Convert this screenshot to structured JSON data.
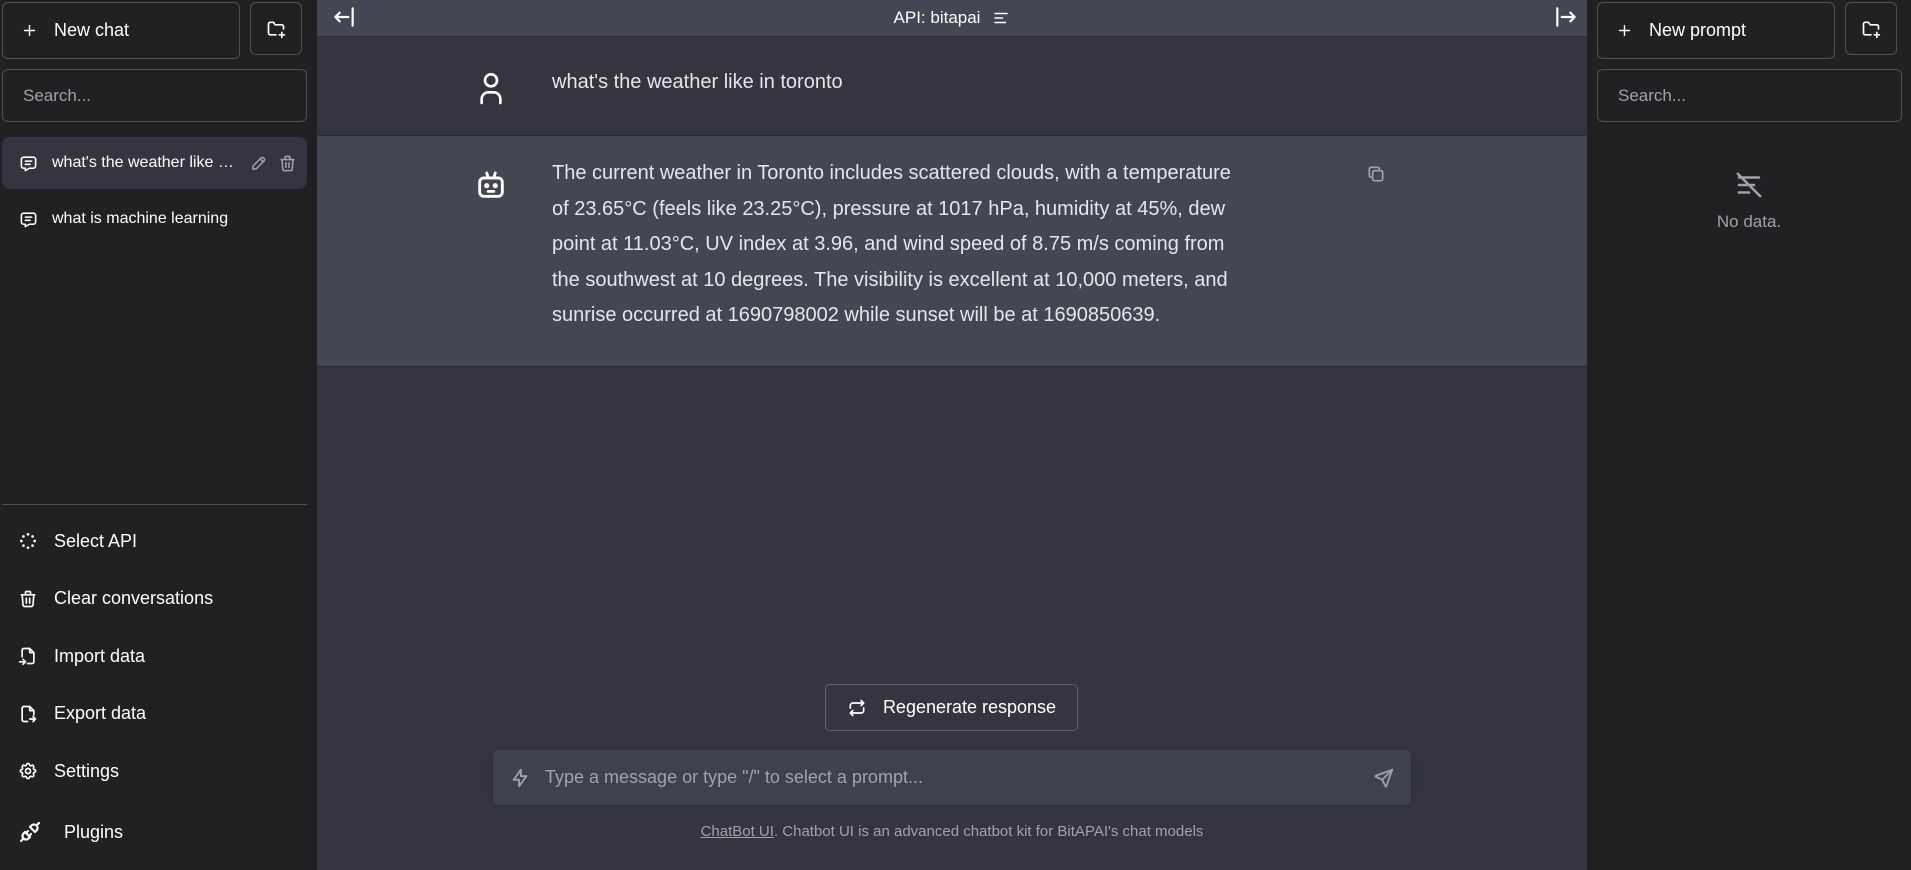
{
  "left_sidebar": {
    "new_chat_label": "New chat",
    "search_placeholder": "Search...",
    "conversations": [
      {
        "title": "what's the weather like in toronto",
        "active": true
      },
      {
        "title": "what is machine learning",
        "active": false
      }
    ],
    "menu": {
      "select_api": "Select API",
      "clear_conversations": "Clear conversations",
      "import_data": "Import data",
      "export_data": "Export data",
      "settings": "Settings",
      "plugins": "Plugins"
    }
  },
  "topbar": {
    "api_label": "API: bitapai"
  },
  "messages": {
    "user_text": "what's the weather like in toronto",
    "assistant_text": "The current weather in Toronto includes scattered clouds, with a temperature of 23.65°C (feels like 23.25°C), pressure at 1017 hPa, humidity at 45%, dew point at 11.03°C, UV index at 3.96, and wind speed of 8.75 m/s coming from the southwest at 10 degrees. The visibility is excellent at 10,000 meters, and sunrise occurred at 1690798002 while sunset will be at 1690850639."
  },
  "composer": {
    "regenerate_label": "Regenerate response",
    "input_placeholder": "Type a message or type \"/\" to select a prompt...",
    "footer_link": "ChatBot UI",
    "footer_text": ". Chatbot UI is an advanced chatbot kit for BitAPAI's chat models"
  },
  "right_sidebar": {
    "new_prompt_label": "New prompt",
    "search_placeholder": "Search...",
    "empty_text": "No data."
  },
  "colors": {
    "sidebar_bg": "#202123",
    "main_bg": "#343541",
    "assistant_bg": "#444654",
    "input_bg": "#40414f",
    "text": "#ececf1",
    "muted": "#a1a1aa"
  }
}
